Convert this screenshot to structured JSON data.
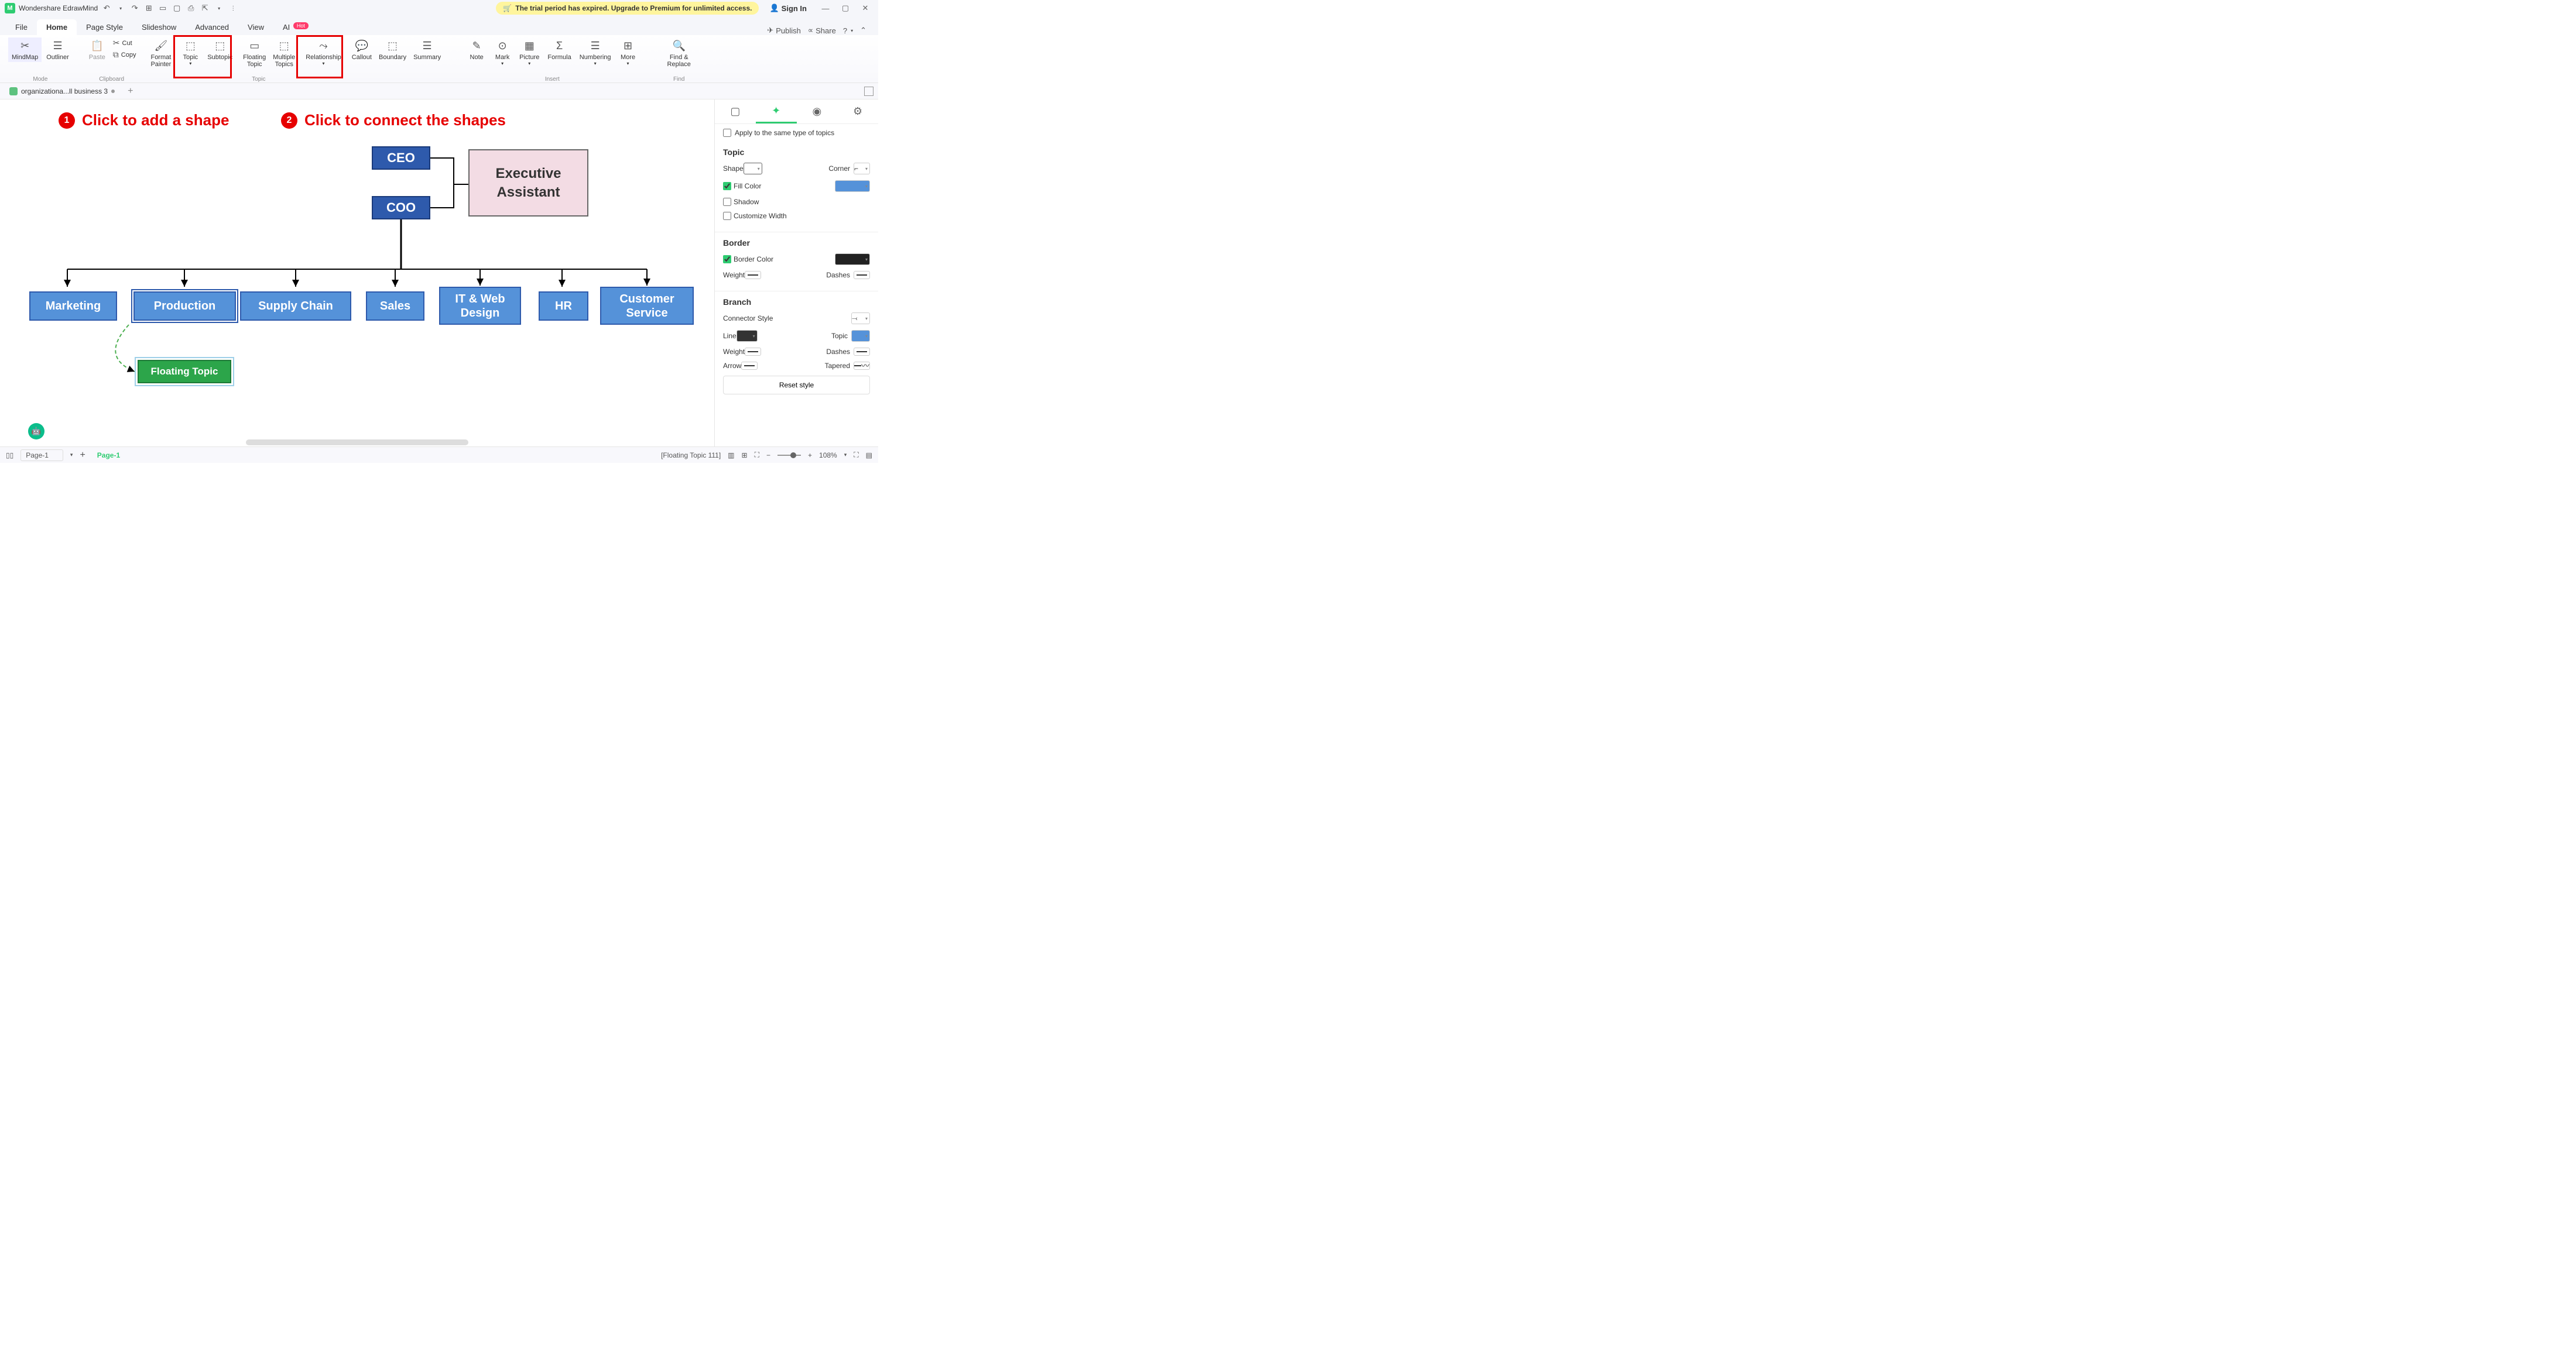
{
  "titlebar": {
    "app_name": "Wondershare EdrawMind",
    "trial_text": "The trial period has expired. Upgrade to Premium for unlimited access.",
    "sign_in": "Sign In"
  },
  "menu": {
    "items": [
      "File",
      "Home",
      "Page Style",
      "Slideshow",
      "Advanced",
      "View",
      "AI"
    ],
    "ai_badge": "Hot",
    "publish": "Publish",
    "share": "Share"
  },
  "ribbon": {
    "mindmap": "MindMap",
    "outliner": "Outliner",
    "mode": "Mode",
    "paste": "Paste",
    "cut": "Cut",
    "copy": "Copy",
    "clipboard": "Clipboard",
    "format_painter": "Format\nPainter",
    "topic": "Topic",
    "subtopic": "Subtopic",
    "floating_topic": "Floating\nTopic",
    "multiple_topics": "Multiple\nTopics",
    "relationship": "Relationship",
    "callout": "Callout",
    "boundary": "Boundary",
    "summary": "Summary",
    "topic_group": "Topic",
    "note": "Note",
    "mark": "Mark",
    "picture": "Picture",
    "formula": "Formula",
    "numbering": "Numbering",
    "more": "More",
    "insert": "Insert",
    "find_replace": "Find &\nReplace",
    "find": "Find"
  },
  "doc_tab": {
    "name": "organizationa...ll business 3"
  },
  "annotations": {
    "step1": "Click to add a shape",
    "step2": "Click to connect the shapes"
  },
  "chart_data": {
    "type": "org-chart",
    "nodes": {
      "ceo": "CEO",
      "coo": "COO",
      "exec": "Executive Assistant",
      "depts": [
        "Marketing",
        "Production",
        "Supply Chain",
        "Sales",
        "IT & Web Design",
        "HR",
        "Customer Service"
      ],
      "floating": "Floating Topic"
    },
    "selected": "Production"
  },
  "right_panel": {
    "apply_same": "Apply to the same type of topics",
    "topic_heading": "Topic",
    "shape": "Shape",
    "corner": "Corner",
    "fill_color": "Fill Color",
    "shadow": "Shadow",
    "customize_width": "Customize Width",
    "border_heading": "Border",
    "border_color": "Border Color",
    "weight": "Weight",
    "dashes": "Dashes",
    "branch_heading": "Branch",
    "connector_style": "Connector Style",
    "line": "Line",
    "topic_lbl": "Topic",
    "arrow": "Arrow",
    "tapered": "Tapered",
    "reset": "Reset style",
    "colors": {
      "fill": "#5592d9",
      "border": "#222222",
      "line": "#333333",
      "topic": "#5592d9"
    }
  },
  "status": {
    "page_select": "Page-1",
    "page_tab": "Page-1",
    "selection": "[Floating Topic 111]",
    "zoom": "108%"
  }
}
